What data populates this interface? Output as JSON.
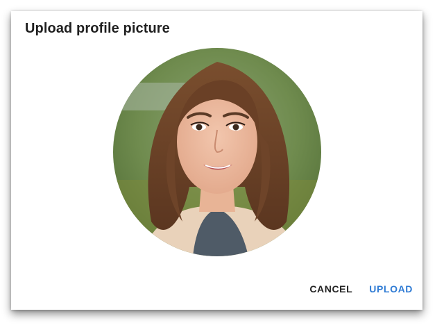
{
  "dialog": {
    "title": "Upload profile picture",
    "cancel_label": "CANCEL",
    "upload_label": "UPLOAD"
  },
  "colors": {
    "upload_accent": "#2f7bd4",
    "cancel_text": "#222222"
  },
  "icons": {
    "avatar": "profile-photo-woman"
  }
}
